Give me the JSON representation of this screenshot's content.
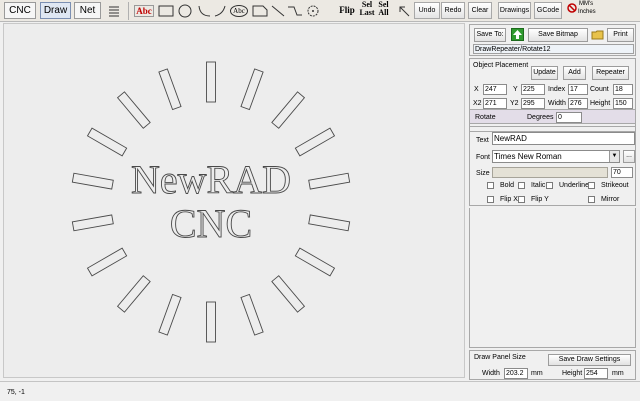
{
  "tabs": {
    "cnc": "CNC",
    "draw": "Draw",
    "net": "Net"
  },
  "tools": {
    "abc_text": "Abc",
    "abc_circle": "Abc",
    "flip": "Flip",
    "sel_last_top": "Sel",
    "sel_last_bottom": "Last",
    "sel_all_top": "Sel",
    "sel_all_bottom": "All"
  },
  "toolbar": {
    "undo": "Undo",
    "redo": "Redo",
    "clear": "Clear",
    "drawings": "Drawings",
    "gcode": "GCode",
    "mm_label": "MM's",
    "inches_label": "Inches"
  },
  "canvas": {
    "line1": "NewRAD",
    "line2": "CNC",
    "outline_color": "#4a4a4a"
  },
  "file": {
    "save_to": "Save To:",
    "save_bitmap": "Save Bitmap",
    "print": "Print",
    "path": "DrawRepeater/Rotate12"
  },
  "placement": {
    "title": "Object Placement",
    "update": "Update",
    "add": "Add",
    "repeater": "Repeater",
    "x_label": "X",
    "x_value": "247",
    "y_label": "Y",
    "y_value": "225",
    "index_label": "Index",
    "index_value": "17",
    "count_label": "Count",
    "count_value": "18",
    "x2_label": "X2",
    "x2_value": "271",
    "y2_label": "Y2",
    "y2_value": "295",
    "width_label": "Width",
    "width_value": "276",
    "height_label": "Height",
    "height_value": "150"
  },
  "rotate": {
    "label": "Rotate",
    "degrees_label": "Degrees",
    "degrees_value": "0"
  },
  "text_props": {
    "text_label": "Text",
    "text_value": "NewRAD",
    "font_label": "Font",
    "font_value": "Times New Roman",
    "more_button": "...",
    "size_label": "Size",
    "size_value": "70",
    "bold": "Bold",
    "italic": "Italic",
    "underline": "Underline",
    "strikeout": "Strikeout",
    "flip_x": "Flip X",
    "flip_y": "Flip Y",
    "mirror": "Mirror"
  },
  "panel_size": {
    "title": "Draw Panel Size",
    "save_settings": "Save Draw Settings",
    "width_label": "Width",
    "width_value": "203.2",
    "width_unit": "mm",
    "height_label": "Height",
    "height_value": "254",
    "height_unit": "mm"
  },
  "status": {
    "coords": "75, -1"
  }
}
